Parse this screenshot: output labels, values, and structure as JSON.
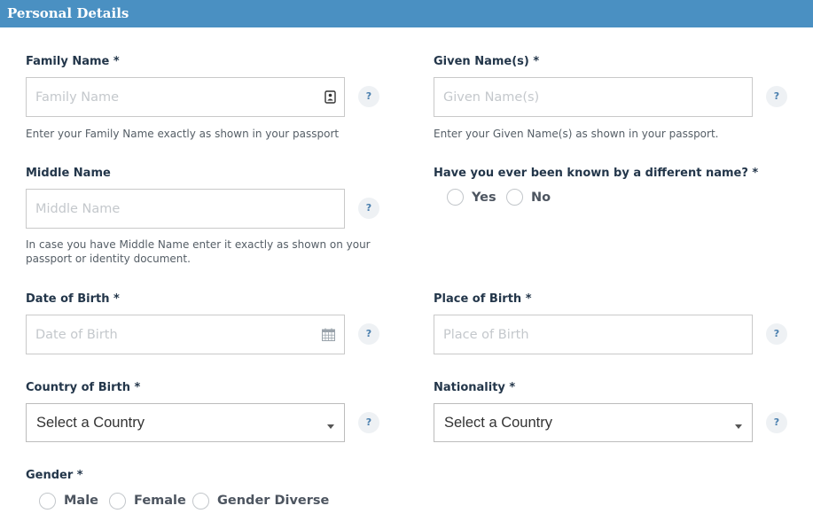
{
  "header": {
    "title": "Personal Details"
  },
  "family_name": {
    "label": "Family Name *",
    "placeholder": "Family Name",
    "help": "?",
    "hint": "Enter your Family Name exactly as shown in your passport"
  },
  "given_names": {
    "label": "Given Name(s) *",
    "placeholder": "Given Name(s)",
    "help": "?",
    "hint": "Enter your Given Name(s) as shown in your passport."
  },
  "middle_name": {
    "label": "Middle Name",
    "placeholder": "Middle Name",
    "help": "?",
    "hint_line1": "In case you have Middle Name enter it exactly as shown on your",
    "hint_line2": "passport or identity document."
  },
  "known_by_other_name": {
    "label": "Have you ever been known by a different name? *",
    "options": [
      "Yes",
      "No"
    ]
  },
  "date_of_birth": {
    "label": "Date of Birth *",
    "placeholder": "Date of Birth",
    "help": "?"
  },
  "place_of_birth": {
    "label": "Place of Birth *",
    "placeholder": "Place of Birth",
    "help": "?"
  },
  "country_of_birth": {
    "label": "Country of Birth *",
    "selected": "Select a Country",
    "help": "?"
  },
  "nationality": {
    "label": "Nationality *",
    "selected": "Select a Country",
    "help": "?"
  },
  "gender": {
    "label": "Gender *",
    "options": [
      "Male",
      "Female",
      "Gender Diverse"
    ]
  },
  "colors": {
    "header_bg": "#4a90c2",
    "label_text": "#23364a",
    "help_text": "#4a7fae",
    "field_border": "#c9c9c9"
  },
  "icons": {
    "family_name_field": "contact-card-icon",
    "date_of_birth_field": "calendar-icon",
    "dropdown": "caret-down-icon"
  }
}
